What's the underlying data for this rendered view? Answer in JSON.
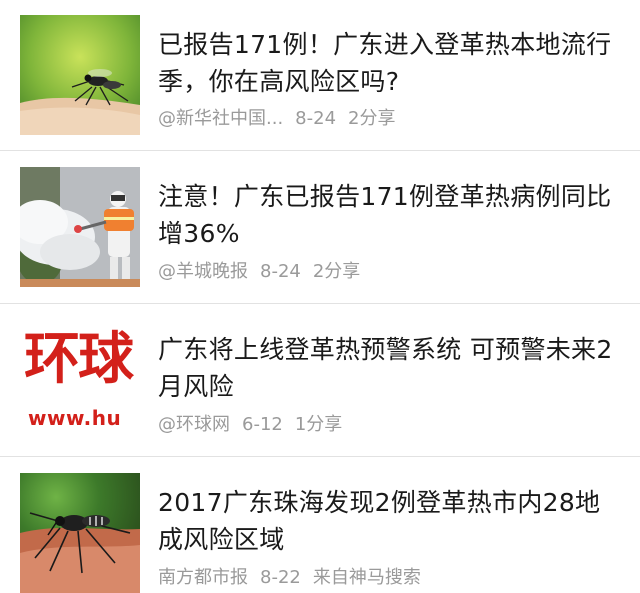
{
  "items": [
    {
      "title": "已报告171例！广东进入登革热本地流行季，你在高风险区吗?",
      "source": "@新华社中国...",
      "date": "8-24",
      "shares": "2分享",
      "thumb_icon": "mosquito-on-skin-image"
    },
    {
      "title": "注意！广东已报告171例登革热病例同比增36%",
      "source": "@羊城晚报",
      "date": "8-24",
      "shares": "2分享",
      "thumb_icon": "fogging-worker-image"
    },
    {
      "title": "广东将上线登革热预警系统 可预警未来2月风险",
      "source": "@环球网",
      "date": "6-12",
      "shares": "1分享",
      "thumb_icon": "huanqiu-logo-image",
      "thumb_logo_text": "环球",
      "thumb_url_text": "www.hu"
    },
    {
      "title": "2017广东珠海发现2例登革热市内28地成风险区域",
      "source": "南方都市报",
      "date": "8-22",
      "shares": "来自神马搜索",
      "thumb_icon": "mosquito-closeup-image"
    }
  ]
}
